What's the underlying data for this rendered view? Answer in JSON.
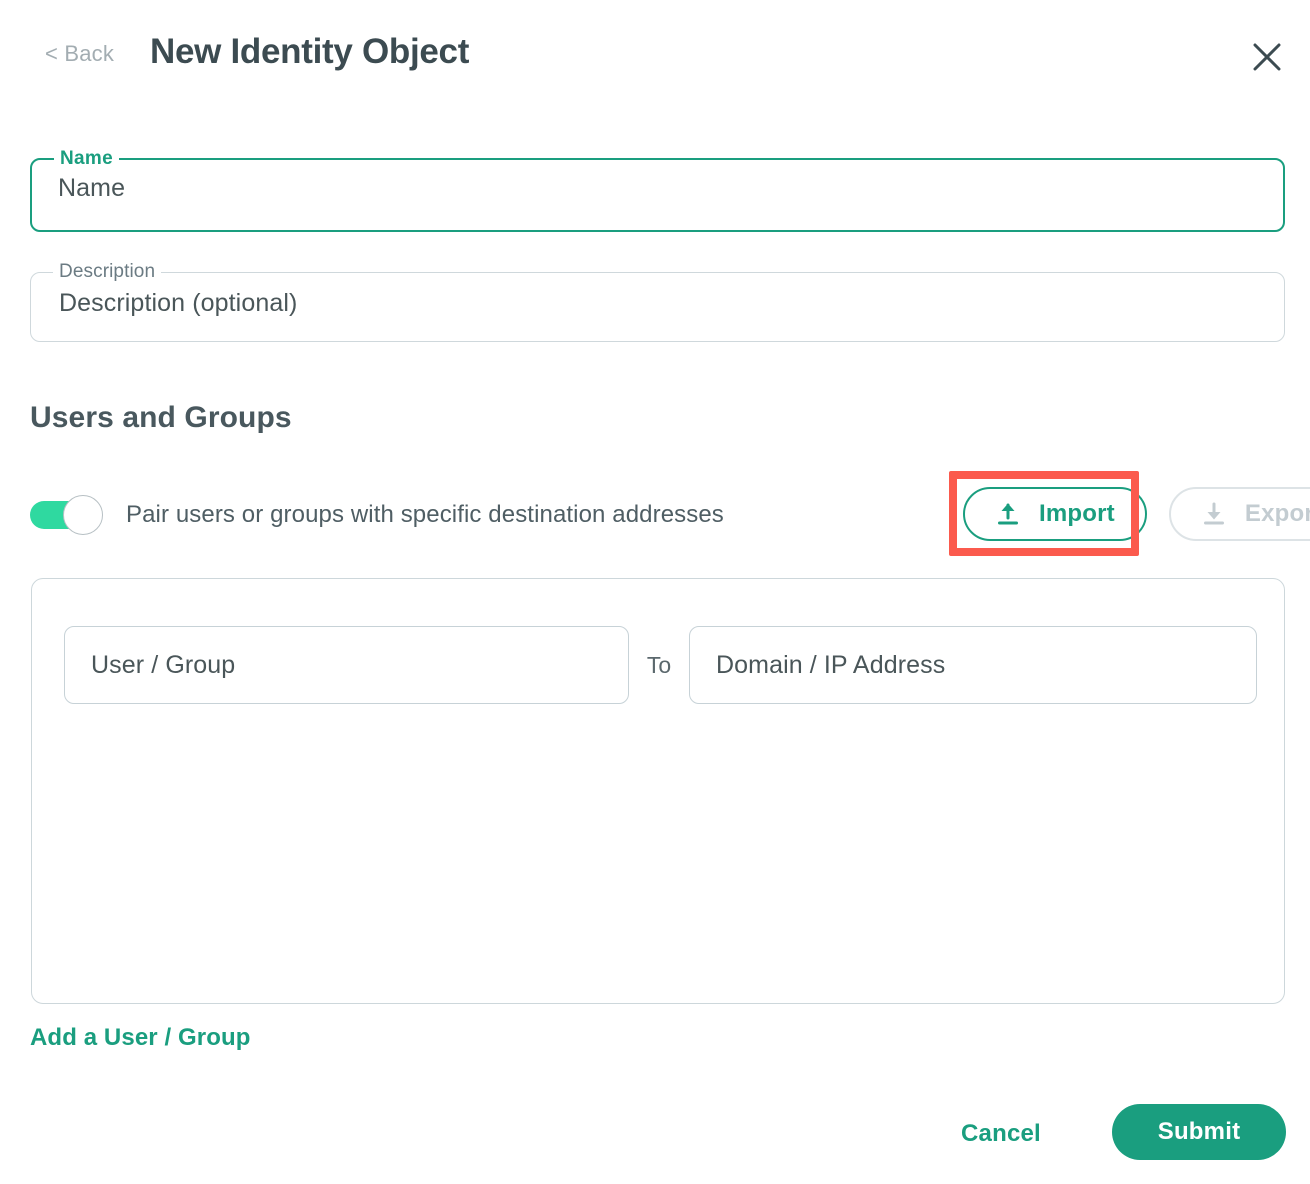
{
  "header": {
    "back_label": "< Back",
    "title": "New Identity Object",
    "close_icon": "close-icon"
  },
  "form": {
    "name": {
      "label": "Name",
      "value": "",
      "placeholder": "Name",
      "focused": true
    },
    "description": {
      "label": "Description",
      "value": "",
      "placeholder": "Description (optional)",
      "focused": false
    }
  },
  "users_and_groups": {
    "section_title": "Users and Groups",
    "toggle": {
      "label": "Pair users or groups with specific destination addresses",
      "state": "on"
    },
    "import_button": {
      "label": "Import",
      "icon": "upload-icon",
      "enabled": true,
      "highlighted": true
    },
    "export_button": {
      "label": "Export",
      "icon": "download-icon",
      "enabled": false
    },
    "pair_row": {
      "user_group_placeholder": "User / Group",
      "to_label": "To",
      "domain_ip_placeholder": "Domain / IP Address"
    },
    "add_link": "Add a User / Group"
  },
  "footer": {
    "cancel_label": "Cancel",
    "submit_label": "Submit"
  },
  "colors": {
    "accent_teal": "#1a9e7f",
    "toggle_green": "#2fd9a0",
    "highlight_red": "#fb5a4d",
    "title_slate": "#3c4b51",
    "muted_gray": "#a3adb2",
    "border_gray": "#cdd7db",
    "disabled_gray": "#c3ccd1"
  }
}
